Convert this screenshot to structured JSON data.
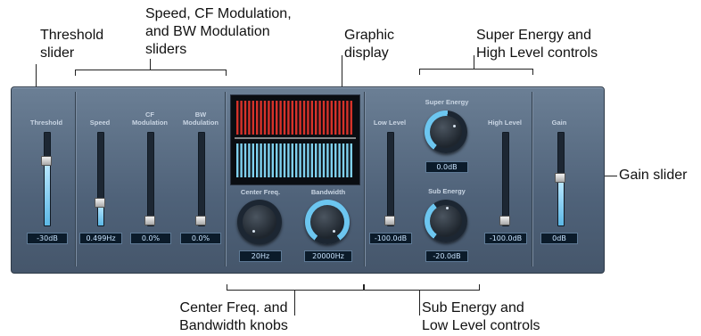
{
  "callouts": {
    "threshold_slider": [
      "Threshold",
      "slider"
    ],
    "speed_cf_bw": [
      "Speed, CF Modulation,",
      "and BW Modulation",
      "sliders"
    ],
    "graphic_display": [
      "Graphic",
      "display"
    ],
    "super_energy_high": [
      "Super Energy and",
      "High Level controls"
    ],
    "gain_slider": "Gain slider",
    "center_bandwidth": [
      "Center Freq. and",
      "Bandwidth knobs"
    ],
    "sub_energy_low": [
      "Sub Energy and",
      "Low Level controls"
    ]
  },
  "plugin": {
    "threshold": {
      "label": "Threshold",
      "value": "-30dB",
      "level": 0.55
    },
    "speed": {
      "label": "Speed",
      "value": "0.499Hz",
      "level": 0.15
    },
    "cf_modulation": {
      "label": "CF\nModulation",
      "value": "0.0%",
      "level": 0.0
    },
    "bw_modulation": {
      "label": "BW\nModulation",
      "value": "0.0%",
      "level": 0.0
    },
    "center_freq": {
      "label": "Center Freq.",
      "value": "20Hz"
    },
    "bandwidth": {
      "label": "Bandwidth",
      "value": "20000Hz"
    },
    "low_level": {
      "label": "Low Level",
      "value": "-100.0dB",
      "level": 0.0
    },
    "super_energy": {
      "label": "Super Energy",
      "value": "0.0dB"
    },
    "sub_energy": {
      "label": "Sub Energy",
      "value": "-20.0dB"
    },
    "high_level": {
      "label": "High Level",
      "value": "-100.0dB",
      "level": 0.0
    },
    "gain": {
      "label": "Gain",
      "value": "0dB",
      "level": 0.5
    }
  },
  "colors": {
    "accent_blue": "#6cc6f0",
    "display_red": "#d6322a",
    "display_blue": "#7fd0ee"
  }
}
